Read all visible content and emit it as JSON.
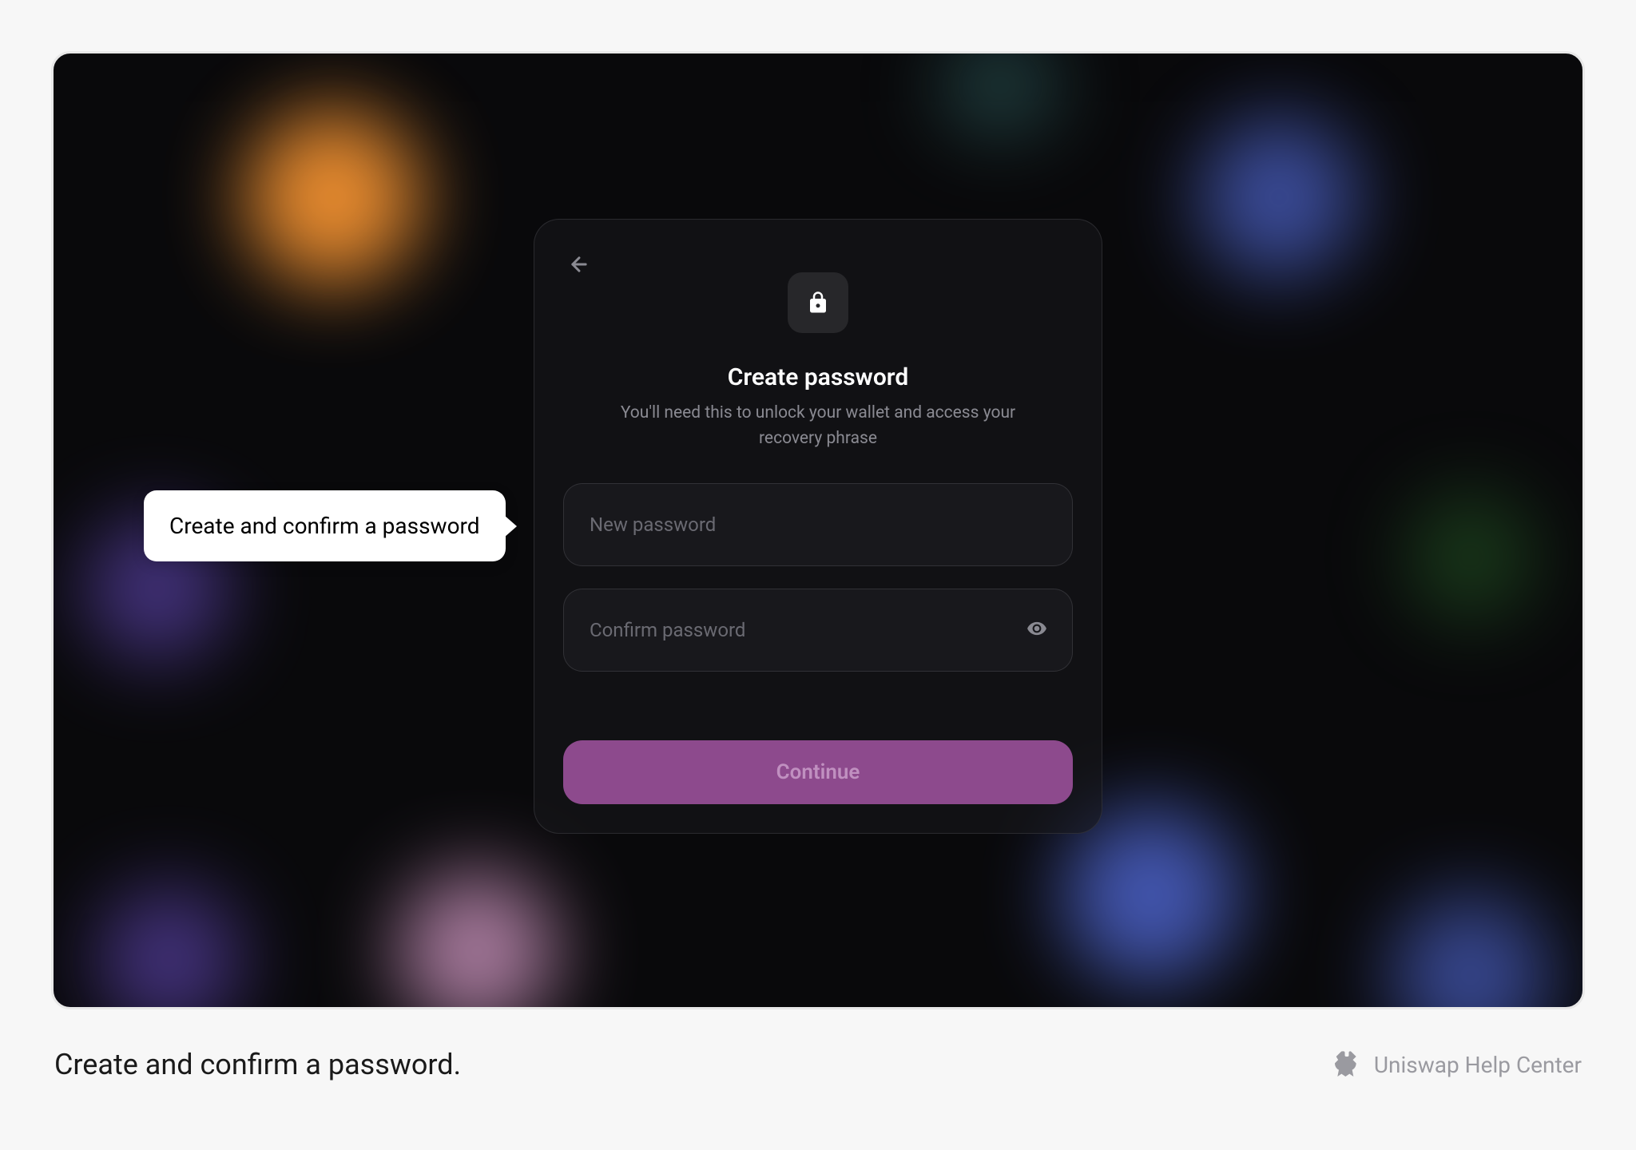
{
  "modal": {
    "title": "Create password",
    "subtitle": "You'll need this to unlock your wallet and access your recovery phrase",
    "new_password_placeholder": "New password",
    "confirm_password_placeholder": "Confirm password",
    "continue_label": "Continue"
  },
  "tooltip": {
    "text": "Create and confirm a password"
  },
  "caption": "Create and confirm a password.",
  "brand": "Uniswap Help Center"
}
